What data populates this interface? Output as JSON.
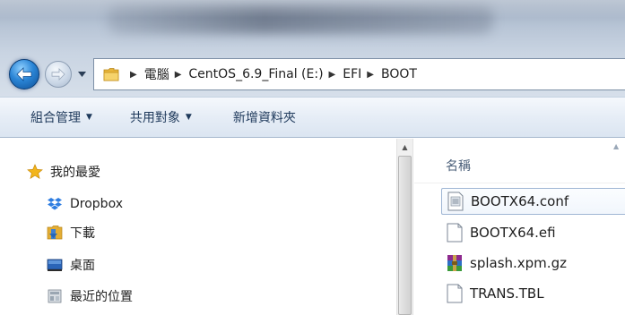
{
  "address_bar": {
    "breadcrumbs": [
      "電腦",
      "CentOS_6.9_Final (E:)",
      "EFI",
      "BOOT"
    ]
  },
  "command_bar": {
    "organize": "組合管理",
    "share": "共用對象",
    "new_folder": "新增資料夾"
  },
  "nav_pane": {
    "items": [
      {
        "label": "我的最愛",
        "icon": "star-icon"
      },
      {
        "label": "Dropbox",
        "icon": "dropbox-icon"
      },
      {
        "label": "下載",
        "icon": "downloads-folder-icon"
      },
      {
        "label": "桌面",
        "icon": "desktop-icon"
      },
      {
        "label": "最近的位置",
        "icon": "recent-places-icon"
      }
    ]
  },
  "file_list": {
    "column_header": "名稱",
    "files": [
      {
        "name": "BOOTX64.conf",
        "icon": "config-file-icon",
        "selected": true
      },
      {
        "name": "BOOTX64.efi",
        "icon": "blank-file-icon",
        "selected": false
      },
      {
        "name": "splash.xpm.gz",
        "icon": "winrar-archive-icon",
        "selected": false
      },
      {
        "name": "TRANS.TBL",
        "icon": "blank-file-icon",
        "selected": false
      }
    ]
  },
  "colors": {
    "back_button": "#2a85d6",
    "command_text": "#1e395b",
    "star": "#f2b51c",
    "dropbox": "#2e7de1"
  }
}
